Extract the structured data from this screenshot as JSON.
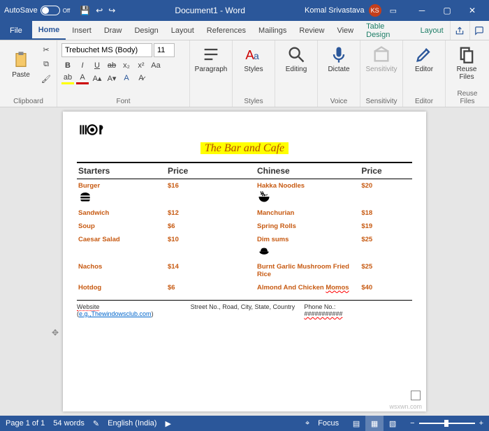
{
  "titlebar": {
    "autosave_label": "AutoSave",
    "autosave_state": "Off",
    "doc_title": "Document1 - Word",
    "user_name": "Komal Srivastava",
    "user_initials": "KS"
  },
  "tabs": {
    "file": "File",
    "home": "Home",
    "insert": "Insert",
    "draw": "Draw",
    "design": "Design",
    "layout": "Layout",
    "references": "References",
    "mailings": "Mailings",
    "review": "Review",
    "view": "View",
    "table_design": "Table Design",
    "table_layout": "Layout"
  },
  "ribbon": {
    "paste": "Paste",
    "clipboard": "Clipboard",
    "font_name": "Trebuchet MS (Body)",
    "font_size": "11",
    "font_group": "Font",
    "paragraph": "Paragraph",
    "styles": "Styles",
    "styles_group": "Styles",
    "editing": "Editing",
    "dictate": "Dictate",
    "voice": "Voice",
    "sensitivity": "Sensitivity",
    "sensitivity_group": "Sensitivity",
    "editor": "Editor",
    "editor_group": "Editor",
    "reuse": "Reuse Files",
    "reuse_group": "Reuse Files"
  },
  "document": {
    "title": "The Bar and Cafe",
    "headers": {
      "c1": "Starters",
      "c2": "Price",
      "c3": "Chinese",
      "c4": "Price"
    },
    "rows": [
      {
        "a": "Burger",
        "ap": "$16",
        "b": "Hakka Noodles",
        "bp": "$20",
        "aicon": "burger",
        "bicon": "noodles"
      },
      {
        "a": "Sandwich",
        "ap": "$12",
        "b": "Manchurian",
        "bp": "$18"
      },
      {
        "a": "Soup",
        "ap": "$6",
        "b": "Spring Rolls",
        "bp": "$19"
      },
      {
        "a": "Caesar Salad",
        "ap": "$10",
        "b": "Dim sums",
        "bp": "$25",
        "bicon": "dimsum"
      },
      {
        "a": "Nachos",
        "ap": "$14",
        "b": "Burnt Garlic Mushroom Fried Rice",
        "bp": "$25"
      },
      {
        "a": "Hotdog",
        "ap": "$6",
        "b": "Almond And Chicken Momos",
        "bp": "$40",
        "bwave": true
      }
    ],
    "footer": {
      "website_label": "Website",
      "website_eg": "e.g.,Thewindowsclub.com",
      "address": "Street No., Road, City, State, Country",
      "phone_label": "Phone No.:",
      "phone_mask": "###########"
    }
  },
  "status": {
    "page": "Page 1 of 1",
    "words": "54 words",
    "lang": "English (India)",
    "focus": "Focus",
    "zoom": "+",
    "zoom_minus": "−"
  },
  "watermark": "wsxwn.com"
}
